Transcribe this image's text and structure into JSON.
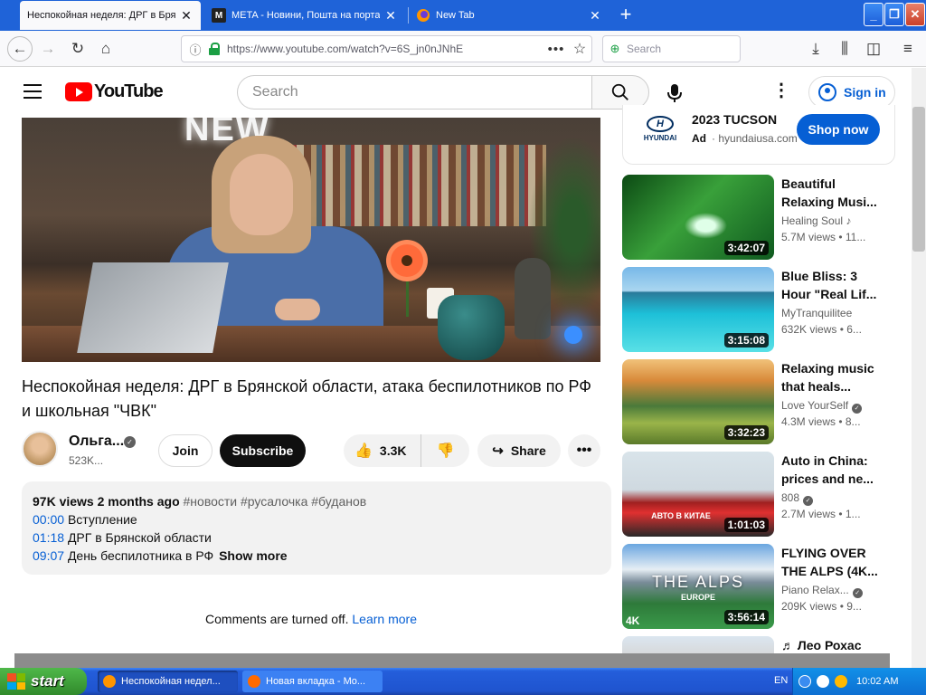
{
  "browser": {
    "tabs": [
      {
        "label": "Неспокойная неделя: ДРГ в Брянской",
        "active": true
      },
      {
        "label": "META - Новини, Пошта на порта",
        "icon": "M",
        "active": false
      },
      {
        "label": "New Tab",
        "active": false
      }
    ],
    "new_tab_symbol": "+",
    "window_controls": {
      "minimize": "_",
      "maximize": "❐",
      "close": "✕"
    },
    "url": "https://www.youtube.com/watch?v=6S_jn0nJNhE",
    "search_placeholder": "Search"
  },
  "youtube": {
    "logo_text": "YouTube",
    "search_placeholder": "Search",
    "sign_in": "Sign in",
    "video": {
      "title": "Неспокойная неделя: ДРГ в Брянской области, атака беспилотников по РФ и школьная \"ЧВК\"",
      "neon_sign": "NEW",
      "channel_name": "Ольга...",
      "subscribers": "523K...",
      "join": "Join",
      "subscribe": "Subscribe",
      "likes": "3.3K",
      "share": "Share"
    },
    "description": {
      "views": "97K views",
      "age": "2 months ago",
      "tags": "#новости #русалочка #буданов",
      "chapters": [
        {
          "time": "00:00",
          "text": "Вступление"
        },
        {
          "time": "01:18",
          "text": "ДРГ в Брянской области"
        },
        {
          "time": "09:07",
          "text": "День беспилотника в РФ"
        }
      ],
      "show_more": "Show more"
    },
    "comments": {
      "text": "Comments are turned off.",
      "link": "Learn more"
    },
    "ad": {
      "brand_logo": "HYUNDAI",
      "brand_mark": "H",
      "title": "2023 TUCSON",
      "label": "Ad",
      "domain": "hyundaiusa.com",
      "cta": "Shop now"
    },
    "recommendations": [
      {
        "title": "Beautiful Relaxing Musi...",
        "channel": "Healing Soul",
        "channel_mark": "♪",
        "stats": "5.7M views • 11...",
        "duration": "3:42:07"
      },
      {
        "title": "Blue Bliss: 3 Hour \"Real Lif...",
        "channel": "MyTranquilitee",
        "stats": "632K views • 6...",
        "duration": "3:15:08"
      },
      {
        "title": "Relaxing music that heals...",
        "channel": "Love YourSelf",
        "verified": true,
        "stats": "4.3M views • 8...",
        "duration": "3:32:23"
      },
      {
        "title": "Auto in China: prices and ne...",
        "channel": "808",
        "verified": true,
        "stats": "2.7M views • 1...",
        "duration": "1:01:03",
        "overlay": "АВТО В КИТАЕ"
      },
      {
        "title": "FLYING OVER THE ALPS (4K...",
        "channel": "Piano Relax...",
        "verified": true,
        "stats": "209K views • 9...",
        "duration": "3:56:14",
        "overlay": "THE ALPS",
        "overlay_small": "EUROPE",
        "badge": "4K"
      }
    ],
    "partial_rec": "♬ Лео Рохас"
  },
  "taskbar": {
    "start": "start",
    "items": [
      {
        "label": "Неспокойная недел..."
      },
      {
        "label": "Новая вкладка - Mo..."
      }
    ],
    "lang": "EN",
    "clock": "10:02 AM"
  }
}
